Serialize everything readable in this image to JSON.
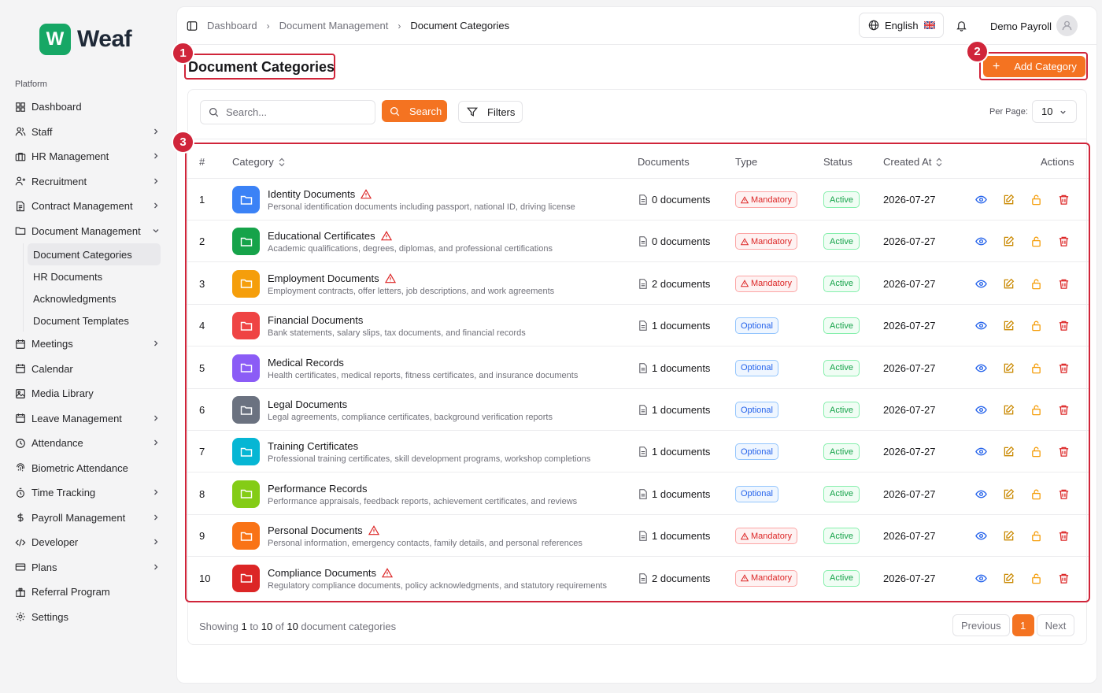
{
  "brand": {
    "logo_letter": "W",
    "name": "Weaf",
    "color": "#16a765"
  },
  "colors": {
    "accent": "#f47321",
    "annotation": "#d0253a",
    "mandatory": "#dc2626",
    "optional": "#2563eb",
    "active": "#16a34a"
  },
  "sidebar": {
    "group_label": "Platform",
    "items": [
      {
        "label": "Dashboard",
        "icon": "dashboard-icon",
        "chevron": false
      },
      {
        "label": "Staff",
        "icon": "users-icon",
        "chevron": true
      },
      {
        "label": "HR Management",
        "icon": "briefcase-icon",
        "chevron": true
      },
      {
        "label": "Recruitment",
        "icon": "user-plus-icon",
        "chevron": true
      },
      {
        "label": "Contract Management",
        "icon": "contract-icon",
        "chevron": true
      },
      {
        "label": "Document Management",
        "icon": "folder-icon",
        "chevron": true,
        "expanded": true
      }
    ],
    "sub_items": [
      "Document Categories",
      "HR Documents",
      "Acknowledgments",
      "Document Templates"
    ],
    "items_after": [
      {
        "label": "Meetings",
        "icon": "calendar-icon",
        "chevron": true
      },
      {
        "label": "Calendar",
        "icon": "calendar-icon",
        "chevron": false
      },
      {
        "label": "Media Library",
        "icon": "image-icon",
        "chevron": false
      },
      {
        "label": "Leave Management",
        "icon": "calendar-icon",
        "chevron": true
      },
      {
        "label": "Attendance",
        "icon": "clock-icon",
        "chevron": true
      },
      {
        "label": "Biometric Attendance",
        "icon": "fingerprint-icon",
        "chevron": false
      },
      {
        "label": "Time Tracking",
        "icon": "timer-icon",
        "chevron": true
      },
      {
        "label": "Payroll Management",
        "icon": "dollar-icon",
        "chevron": true
      },
      {
        "label": "Developer",
        "icon": "code-icon",
        "chevron": true
      },
      {
        "label": "Plans",
        "icon": "card-icon",
        "chevron": true
      },
      {
        "label": "Referral Program",
        "icon": "gift-icon",
        "chevron": false
      },
      {
        "label": "Settings",
        "icon": "gear-icon",
        "chevron": false
      }
    ]
  },
  "header": {
    "breadcrumb": [
      "Dashboard",
      "Document Management",
      "Document Categories"
    ],
    "language": "English",
    "user_name": "Demo Payroll"
  },
  "page": {
    "title": "Document Categories",
    "add_button": "Add Category",
    "annotations": [
      "1",
      "2",
      "3"
    ]
  },
  "filters": {
    "search_placeholder": "Search...",
    "search_button": "Search",
    "filters_button": "Filters",
    "per_page_label": "Per Page:",
    "per_page_value": "10"
  },
  "table": {
    "columns": {
      "num": "#",
      "category": "Category",
      "documents": "Documents",
      "type": "Type",
      "status": "Status",
      "created": "Created At",
      "actions": "Actions"
    },
    "rows": [
      {
        "num": "1",
        "name": "Identity Documents",
        "desc": "Personal identification documents including passport, national ID, driving license",
        "docs": "0 documents",
        "type": "Mandatory",
        "status": "Active",
        "created": "2026-07-27",
        "color": "#3b82f6"
      },
      {
        "num": "2",
        "name": "Educational Certificates",
        "desc": "Academic qualifications, degrees, diplomas, and professional certifications",
        "docs": "0 documents",
        "type": "Mandatory",
        "status": "Active",
        "created": "2026-07-27",
        "color": "#16a34a"
      },
      {
        "num": "3",
        "name": "Employment Documents",
        "desc": "Employment contracts, offer letters, job descriptions, and work agreements",
        "docs": "2 documents",
        "type": "Mandatory",
        "status": "Active",
        "created": "2026-07-27",
        "color": "#f59e0b"
      },
      {
        "num": "4",
        "name": "Financial Documents",
        "desc": "Bank statements, salary slips, tax documents, and financial records",
        "docs": "1 documents",
        "type": "Optional",
        "status": "Active",
        "created": "2026-07-27",
        "color": "#ef4444"
      },
      {
        "num": "5",
        "name": "Medical Records",
        "desc": "Health certificates, medical reports, fitness certificates, and insurance documents",
        "docs": "1 documents",
        "type": "Optional",
        "status": "Active",
        "created": "2026-07-27",
        "color": "#8b5cf6"
      },
      {
        "num": "6",
        "name": "Legal Documents",
        "desc": "Legal agreements, compliance certificates, background verification reports",
        "docs": "1 documents",
        "type": "Optional",
        "status": "Active",
        "created": "2026-07-27",
        "color": "#6b7280"
      },
      {
        "num": "7",
        "name": "Training Certificates",
        "desc": "Professional training certificates, skill development programs, workshop completions",
        "docs": "1 documents",
        "type": "Optional",
        "status": "Active",
        "created": "2026-07-27",
        "color": "#06b6d4"
      },
      {
        "num": "8",
        "name": "Performance Records",
        "desc": "Performance appraisals, feedback reports, achievement certificates, and reviews",
        "docs": "1 documents",
        "type": "Optional",
        "status": "Active",
        "created": "2026-07-27",
        "color": "#84cc16"
      },
      {
        "num": "9",
        "name": "Personal Documents",
        "desc": "Personal information, emergency contacts, family details, and personal references",
        "docs": "1 documents",
        "type": "Mandatory",
        "status": "Active",
        "created": "2026-07-27",
        "color": "#f97316"
      },
      {
        "num": "10",
        "name": "Compliance Documents",
        "desc": "Regulatory compliance documents, policy acknowledgments, and statutory requirements",
        "docs": "2 documents",
        "type": "Mandatory",
        "status": "Active",
        "created": "2026-07-27",
        "color": "#dc2626"
      }
    ]
  },
  "pagination": {
    "showing_prefix": "Showing ",
    "from": "1",
    "to_word": " to ",
    "to": "10",
    "of_word": " of ",
    "total": "10",
    "suffix": " document categories",
    "previous": "Previous",
    "current": "1",
    "next": "Next"
  }
}
